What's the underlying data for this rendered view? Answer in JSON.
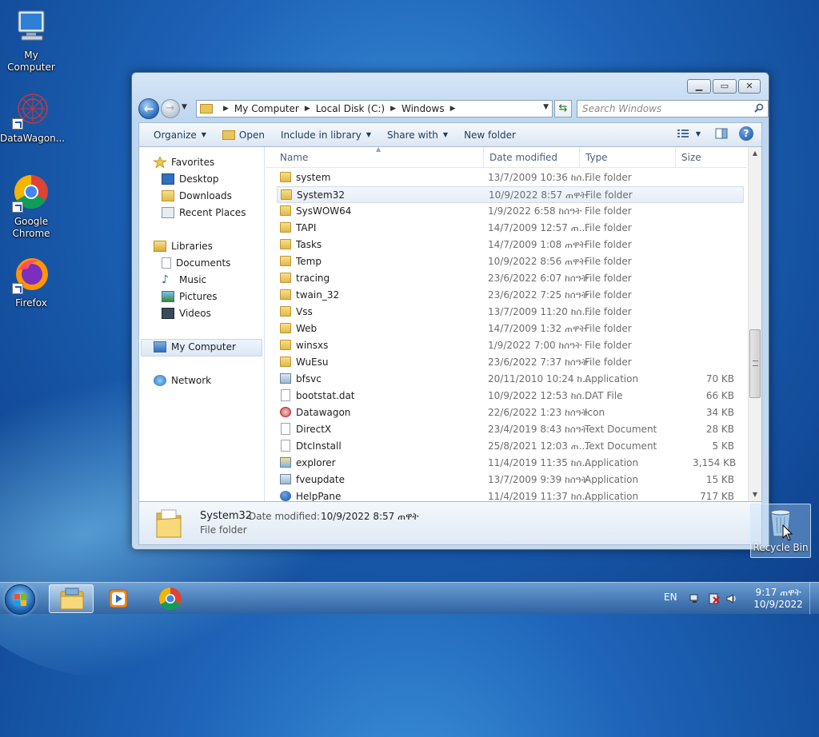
{
  "desktop": {
    "icons": [
      {
        "label": "My Computer"
      },
      {
        "label": "DataWagon..."
      },
      {
        "label": "Google Chrome"
      },
      {
        "label": "Firefox"
      }
    ],
    "recycle_bin": "Recycle Bin"
  },
  "window": {
    "caption_buttons": {
      "minimize": "▁",
      "maximize": "▭",
      "close": "✕"
    },
    "address": {
      "crumbs": [
        "My Computer",
        "Local Disk (C:)",
        "Windows"
      ]
    },
    "search": {
      "placeholder": "Search Windows"
    },
    "toolbar": {
      "organize": "Organize",
      "open": "Open",
      "include_in_library": "Include in library",
      "share_with": "Share with",
      "new_folder": "New folder"
    },
    "nav": {
      "favorites": "Favorites",
      "desktop": "Desktop",
      "downloads": "Downloads",
      "recent_places": "Recent Places",
      "libraries": "Libraries",
      "documents": "Documents",
      "music": "Music",
      "pictures": "Pictures",
      "videos": "Videos",
      "my_computer": "My Computer",
      "network": "Network"
    },
    "columns": {
      "name": "Name",
      "date": "Date modified",
      "type": "Type",
      "size": "Size"
    },
    "files": [
      {
        "name": "system",
        "date": "13/7/2009 10:36 ከሰ...",
        "type": "File folder",
        "size": "",
        "icon": "folder"
      },
      {
        "name": "System32",
        "date": "10/9/2022 8:57 ጠዋት",
        "type": "File folder",
        "size": "",
        "icon": "folder",
        "selected": true
      },
      {
        "name": "SysWOW64",
        "date": "1/9/2022 6:58 ከሰዓት",
        "type": "File folder",
        "size": "",
        "icon": "folder"
      },
      {
        "name": "TAPI",
        "date": "14/7/2009 12:57 ጠ...",
        "type": "File folder",
        "size": "",
        "icon": "folder"
      },
      {
        "name": "Tasks",
        "date": "14/7/2009 1:08 ጠዋት",
        "type": "File folder",
        "size": "",
        "icon": "folder"
      },
      {
        "name": "Temp",
        "date": "10/9/2022 8:56 ጠዋት",
        "type": "File folder",
        "size": "",
        "icon": "folder"
      },
      {
        "name": "tracing",
        "date": "23/6/2022 6:07 ከሰዓት",
        "type": "File folder",
        "size": "",
        "icon": "folder"
      },
      {
        "name": "twain_32",
        "date": "23/6/2022 7:25 ከሰዓት",
        "type": "File folder",
        "size": "",
        "icon": "folder"
      },
      {
        "name": "Vss",
        "date": "13/7/2009 11:20 ከሰ...",
        "type": "File folder",
        "size": "",
        "icon": "folder"
      },
      {
        "name": "Web",
        "date": "14/7/2009 1:32 ጠዋት",
        "type": "File folder",
        "size": "",
        "icon": "folder"
      },
      {
        "name": "winsxs",
        "date": "1/9/2022 7:00 ከሰዓት",
        "type": "File folder",
        "size": "",
        "icon": "folder"
      },
      {
        "name": "WuEsu",
        "date": "23/6/2022 7:37 ከሰዓት",
        "type": "File folder",
        "size": "",
        "icon": "folder"
      },
      {
        "name": "bfsvc",
        "date": "20/11/2010 10:24 ከ...",
        "type": "Application",
        "size": "70 KB",
        "icon": "app"
      },
      {
        "name": "bootstat.dat",
        "date": "10/9/2022 12:53 ከሰ...",
        "type": "DAT File",
        "size": "66 KB",
        "icon": "doc"
      },
      {
        "name": "Datawagon",
        "date": "22/6/2022 1:23 ከሰዓት",
        "type": "Icon",
        "size": "34 KB",
        "icon": "ico"
      },
      {
        "name": "DirectX",
        "date": "23/4/2019 8:43 ከሰዓት",
        "type": "Text Document",
        "size": "28 KB",
        "icon": "doc"
      },
      {
        "name": "DtcInstall",
        "date": "25/8/2021 12:03 ጠ...",
        "type": "Text Document",
        "size": "5 KB",
        "icon": "doc"
      },
      {
        "name": "explorer",
        "date": "11/4/2019 11:35 ከሰ...",
        "type": "Application",
        "size": "3,154 KB",
        "icon": "explorer"
      },
      {
        "name": "fveupdate",
        "date": "13/7/2009 9:39 ከሰዓት",
        "type": "Application",
        "size": "15 KB",
        "icon": "app"
      },
      {
        "name": "HelpPane",
        "date": "11/4/2019 11:37 ከሰ...",
        "type": "Application",
        "size": "717 KB",
        "icon": "help"
      }
    ],
    "details": {
      "name": "System32",
      "date_label": "Date modified:",
      "date_value": "10/9/2022 8:57 ጠዋት",
      "type": "File folder"
    }
  },
  "taskbar": {
    "language": "EN",
    "time": "9:17 ጠዋት",
    "date": "10/9/2022"
  }
}
